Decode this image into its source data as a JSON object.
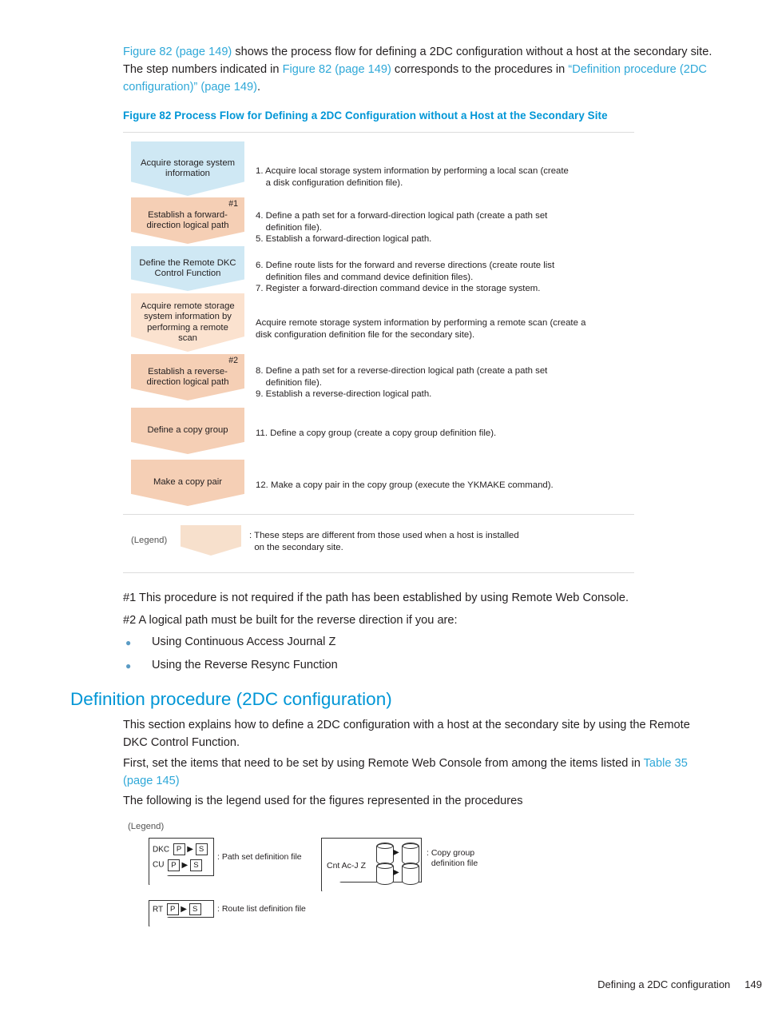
{
  "intro": {
    "link1": "Figure 82 (page 149)",
    "t1": " shows the process flow for defining a 2DC configuration without a host at the secondary site. The step numbers indicated in ",
    "link2": "Figure 82 (page 149)",
    "t2": " corresponds to the procedures in ",
    "link3": "“Definition procedure (2DC configuration)” (page 149)",
    "t3": "."
  },
  "figure": {
    "caption": "Figure 82 Process Flow for Defining a 2DC Configuration without a Host at the Secondary Site",
    "boxes": [
      {
        "label": "Acquire storage system information",
        "tag": "",
        "color": "#cfe8f4"
      },
      {
        "label": "Establish a forward-direction logical path",
        "tag": "#1",
        "color": "#f5cfb5"
      },
      {
        "label": "Define the Remote DKC Control Function",
        "tag": "",
        "color": "#cfe8f4"
      },
      {
        "label": "Acquire remote storage system information by performing a remote scan",
        "tag": "",
        "color": "#fbe2cf"
      },
      {
        "label": "Establish a reverse-direction logical path",
        "tag": "#2",
        "color": "#f5cfb5"
      },
      {
        "label": "Define a copy group",
        "tag": "",
        "color": "#f5cfb5"
      },
      {
        "label": "Make a copy pair",
        "tag": "",
        "color": "#f5cfb5"
      }
    ],
    "steps": [
      "1. Acquire local storage system information by performing a local scan (create\n    a disk configuration definition file).",
      "4. Define a path set for a forward-direction logical path (create a path set\n    definition file).\n5. Establish a forward-direction logical path.",
      "6. Define route lists for the forward and reverse directions (create route list\n    definition files and command device definition files).\n7. Register a forward-direction command device in the storage system.",
      "Acquire remote storage system information by performing a remote scan (create a\ndisk configuration definition file for the secondary site).",
      "8. Define a path set for a reverse-direction logical path (create a path set\n    definition file).\n9. Establish a reverse-direction logical path.",
      "11. Define a copy group (create a copy group definition file).",
      "12. Make a copy pair in the copy group (execute the YKMAKE command)."
    ],
    "legend_label": "(Legend)",
    "legend_text": ": These steps are different from those used when a host is installed\n  on the secondary site."
  },
  "notes": {
    "n1": "#1 This procedure is not required if the path has been established by using Remote Web Console.",
    "n2": "#2 A logical path must be built for the reverse direction if you are:",
    "bullets": [
      "Using Continuous Access Journal Z",
      "Using the Reverse Resync Function"
    ]
  },
  "section": {
    "heading": "Definition procedure (2DC configuration)",
    "p1": "This section explains how to define a 2DC configuration with a host at the secondary site by using the Remote DKC Control Function.",
    "p2_a": "First, set the items that need to be set by using Remote Web Console from among the items listed in ",
    "p2_link": "Table 35 (page 145)",
    "p3": "The following is the legend used for the figures represented in the procedures"
  },
  "legend_figure": {
    "title": "(Legend)",
    "row1_label": "DKC",
    "row2_label": "CU",
    "row3_label": "RT",
    "p_box": "P",
    "s_box": "S",
    "cap1": ": Path set definition file",
    "cap2": ": Route list definition file",
    "cap3_label": "Cnt Ac-J Z",
    "cap3": ": Copy group\n  definition file"
  },
  "footer": {
    "chapter": "Defining a 2DC configuration",
    "page": "149"
  },
  "colors": {
    "link": "#2fa8d8",
    "heading": "#0096d6",
    "blue_box": "#cfe8f4",
    "peach_box": "#f5cfb5",
    "peach_light": "#fbe2cf",
    "legend_shape": "#f7e0cc"
  }
}
